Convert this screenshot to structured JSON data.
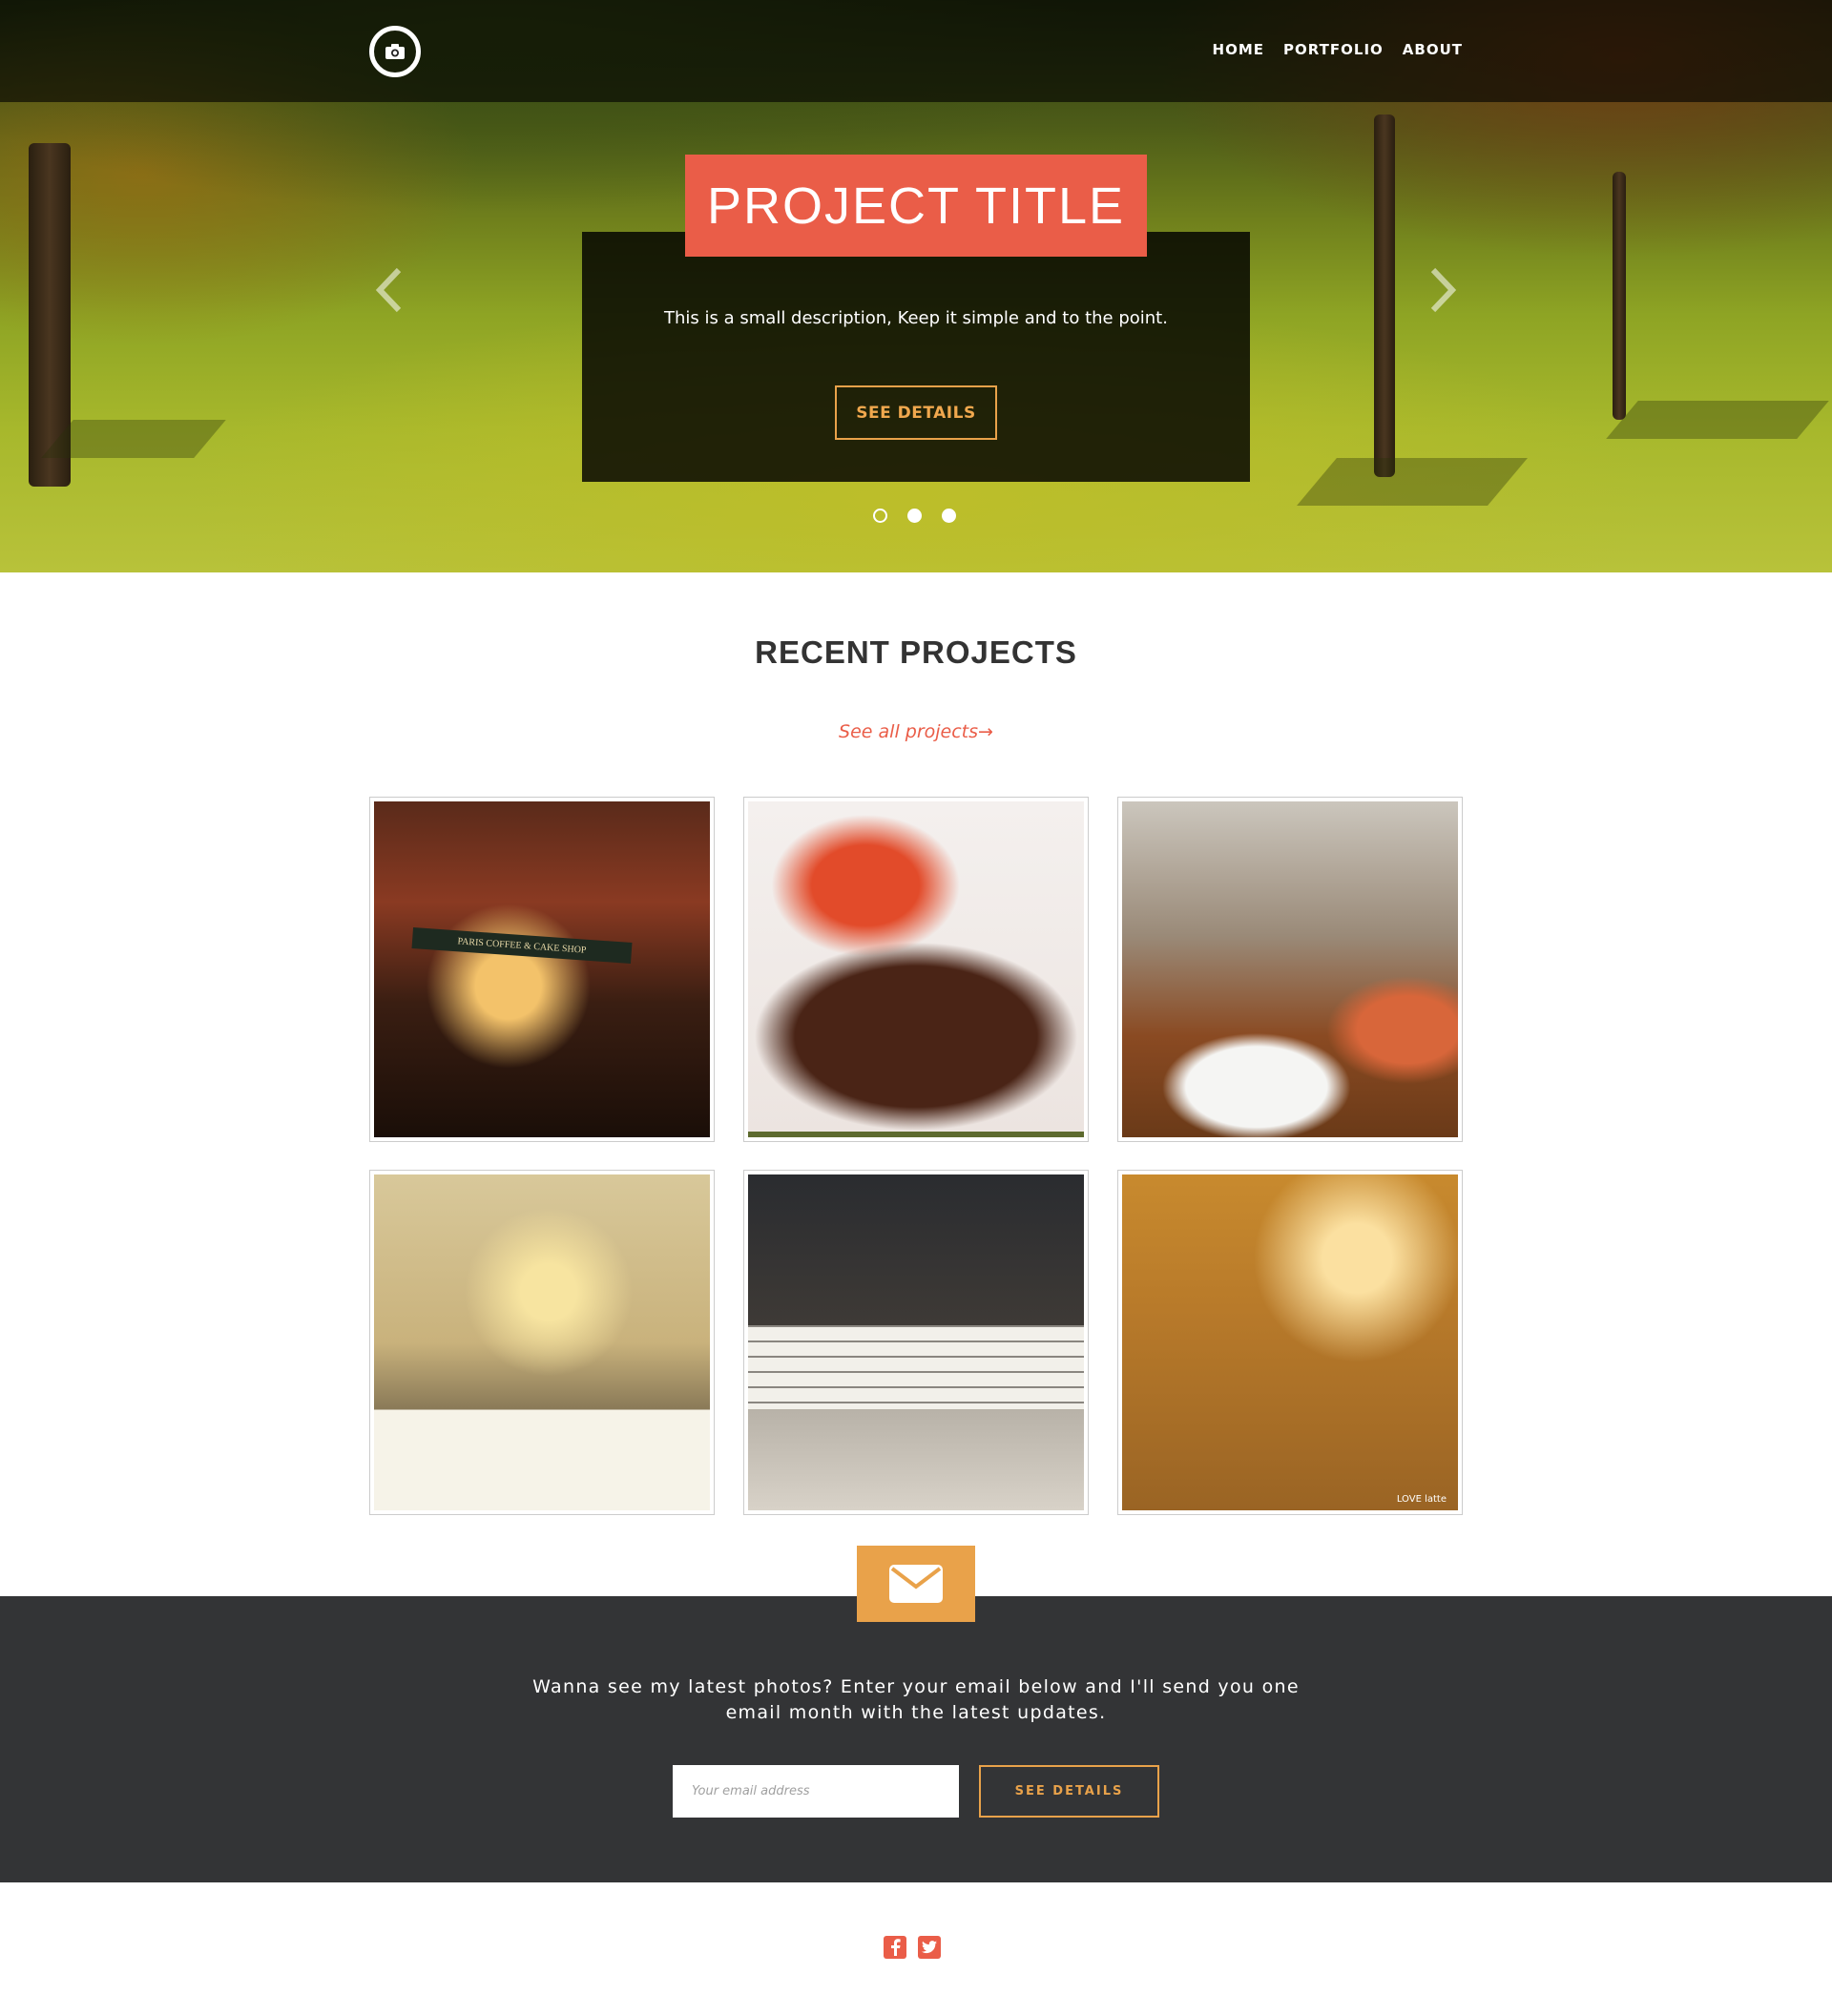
{
  "nav": {
    "logo_icon": "camera-icon",
    "links": [
      "HOME",
      "PORTFOLIO",
      "ABOUT"
    ]
  },
  "hero": {
    "title": "PROJECT TITLE",
    "description": "This is a small description, Keep it simple and to the point.",
    "button_label": "SEE DETAILS",
    "prev_icon": "chevron-left-icon",
    "next_icon": "chevron-right-icon",
    "slide_count": 3,
    "active_slide": 1
  },
  "projects": {
    "title": "RECENT PROJECTS",
    "see_all_label": "See all projects→",
    "items": [
      {
        "subject": "cafe-dollhouse",
        "caption": "PARIS COFFEE & CAKE SHOP"
      },
      {
        "subject": "steak-plate"
      },
      {
        "subject": "restaurant-table"
      },
      {
        "subject": "banquet-hall"
      },
      {
        "subject": "cafeteria-interior"
      },
      {
        "subject": "coffee-shop-window",
        "caption": "LOVE latte"
      }
    ]
  },
  "newsletter": {
    "icon": "envelope-icon",
    "text": "Wanna see my latest photos? Enter your email below and I'll send you one email month with the latest updates.",
    "email_placeholder": "Your email address",
    "button_label": "SEE DETAILS"
  },
  "footer": {
    "social_icons": [
      "facebook-icon",
      "twitter-icon"
    ]
  },
  "colors": {
    "accent_red": "#ea5d48",
    "accent_orange": "#e9a24a",
    "dark_band": "#333436"
  }
}
